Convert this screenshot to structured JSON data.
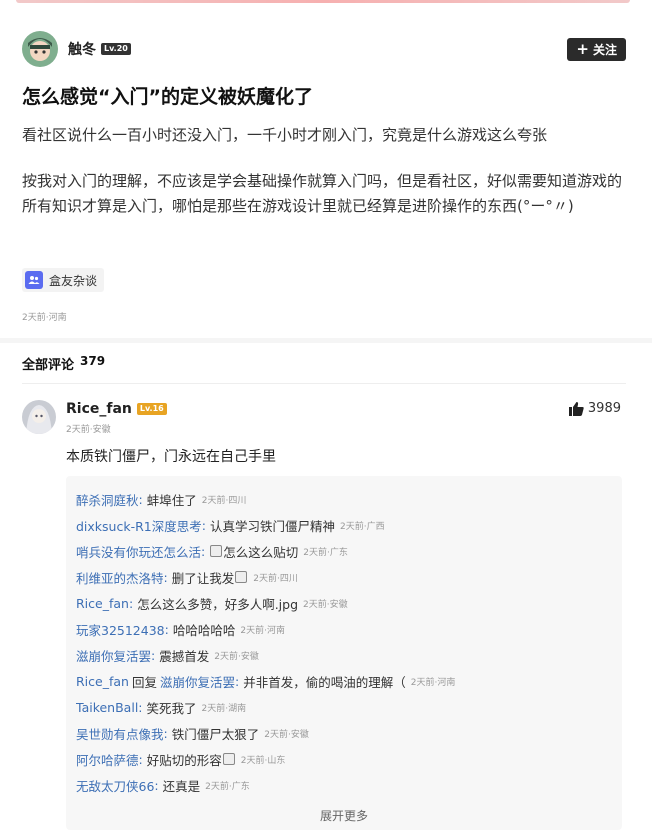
{
  "post": {
    "author": {
      "name": "触冬",
      "level": "Lv.20"
    },
    "follow_label": "关注",
    "title": "怎么感觉“入门”的定义被妖魔化了",
    "paragraphs": [
      "看社区说什么一百小时还没入门，一千小时才刚入门，究竟是什么游戏这么夸张",
      "按我对入门的理解，不应该是学会基础操作就算入门吗，但是看社区，好似需要知道游戏的所有知识才算是入门，哪怕是那些在游戏设计里就已经算是进阶操作的东西(°ー°〃)"
    ],
    "topic_tag": "盒友杂谈",
    "meta": "2天前·河南"
  },
  "comments_section": {
    "title": "全部评论",
    "count": "379"
  },
  "top_comment": {
    "user": "Rice_fan",
    "level": "Lv.16",
    "meta": "2天前·安徽",
    "likes": "3989",
    "text": "本质铁门僵尸，门永远在自己手里"
  },
  "replies": [
    {
      "user": "醉杀洞庭秋",
      "text": "蚌埠住了",
      "meta": "2天前·四川"
    },
    {
      "user": "dixksuck-R1深度思考",
      "text": "认真学习铁门僵尸精神",
      "meta": "2天前·广西"
    },
    {
      "user": "哨兵没有你玩还怎么活",
      "text": "怎么这么贴切",
      "meta": "2天前·广东",
      "emoji_before": true
    },
    {
      "user": "利维亚的杰洛特",
      "text": "删了让我发",
      "meta": "2天前·四川",
      "emoji_after": true
    },
    {
      "user": "Rice_fan",
      "text": "怎么这么多赞，好多人啊.jpg",
      "meta": "2天前·安徽"
    },
    {
      "user": "玩家32512438",
      "text": "哈哈哈哈哈",
      "meta": "2天前·河南"
    },
    {
      "user": "滋崩你复活罢",
      "text": "震撼首发",
      "meta": "2天前·安徽"
    },
    {
      "user": "Rice_fan",
      "mid": "回复",
      "target": "滋崩你复活罢",
      "text": "并非首发，偷的喝油的理解（",
      "meta": "2天前·河南"
    },
    {
      "user": "TaikenBall",
      "text": "笑死我了",
      "meta": "2天前·湖南"
    },
    {
      "user": "吴世勋有点像我",
      "text": "铁门僵尸太狠了",
      "meta": "2天前·安徽"
    },
    {
      "user": "阿尔哈萨德",
      "text": "好贴切的形容",
      "meta": "2天前·山东",
      "emoji_after": true
    },
    {
      "user": "无敌太刀侠66",
      "text": "还真是",
      "meta": "2天前·广东"
    }
  ],
  "more_replies_label": "展开更多"
}
